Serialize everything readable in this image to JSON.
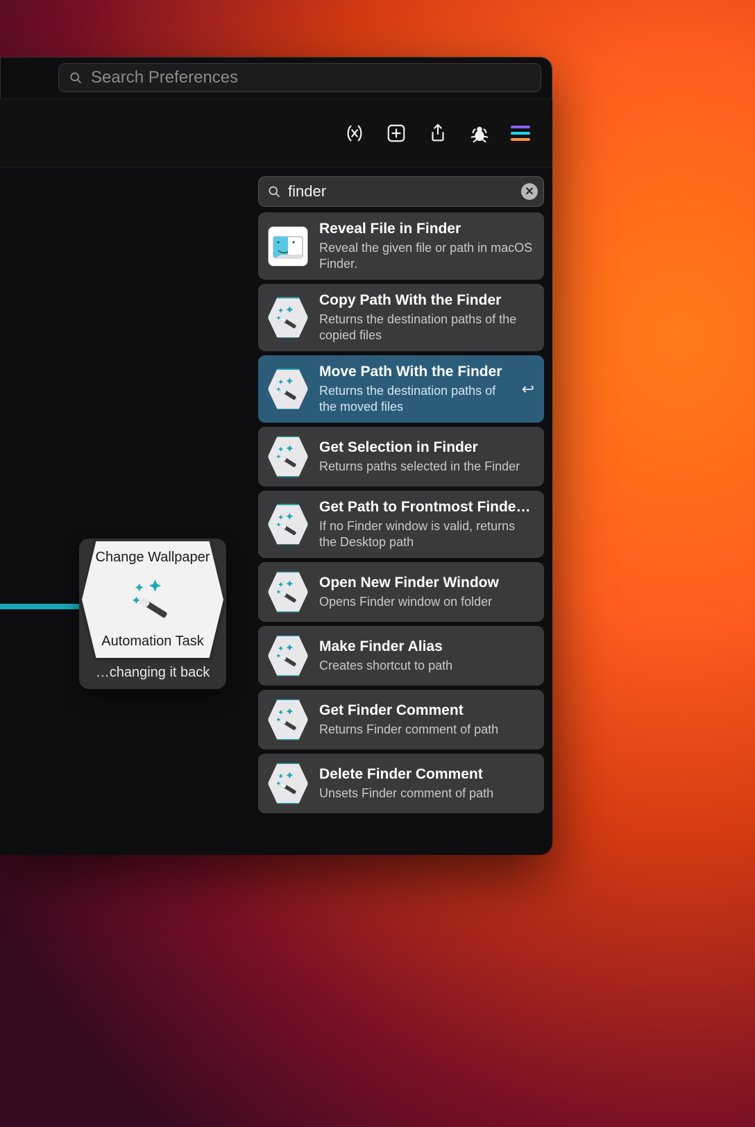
{
  "titlebar": {
    "search_placeholder": "Search Preferences"
  },
  "toolbar_icons": [
    "variable",
    "add",
    "share",
    "debug",
    "menu"
  ],
  "node": {
    "title": "Change Wallpaper",
    "subtitle": "Automation Task",
    "caption": "…changing it back"
  },
  "panel": {
    "query": "finder",
    "results": [
      {
        "icon": "finder",
        "title": "Reveal File in Finder",
        "desc": "Reveal the given file or path in macOS Finder.",
        "selected": false
      },
      {
        "icon": "hexwand",
        "title": "Copy Path With the Finder",
        "desc": "Returns the destination paths of the copied files",
        "selected": false
      },
      {
        "icon": "hexwand",
        "title": "Move Path With the Finder",
        "desc": "Returns the destination paths of the moved files",
        "selected": true
      },
      {
        "icon": "hexwand",
        "title": "Get Selection in Finder",
        "desc": "Returns paths selected in the Finder",
        "selected": false
      },
      {
        "icon": "hexwand",
        "title": "Get Path to Frontmost Finder W…",
        "desc": "If no Finder window is valid, returns the Desktop path",
        "selected": false
      },
      {
        "icon": "hexwand",
        "title": "Open New Finder Window",
        "desc": "Opens Finder window on folder",
        "selected": false
      },
      {
        "icon": "hexwand",
        "title": "Make Finder Alias",
        "desc": "Creates shortcut to path",
        "selected": false
      },
      {
        "icon": "hexwand",
        "title": "Get Finder Comment",
        "desc": "Returns Finder comment of path",
        "selected": false
      },
      {
        "icon": "hexwand",
        "title": "Delete Finder Comment",
        "desc": "Unsets Finder comment of path",
        "selected": false
      }
    ]
  },
  "colors": {
    "accent": "#1aa8b8",
    "selected": "#2b5d7a"
  }
}
